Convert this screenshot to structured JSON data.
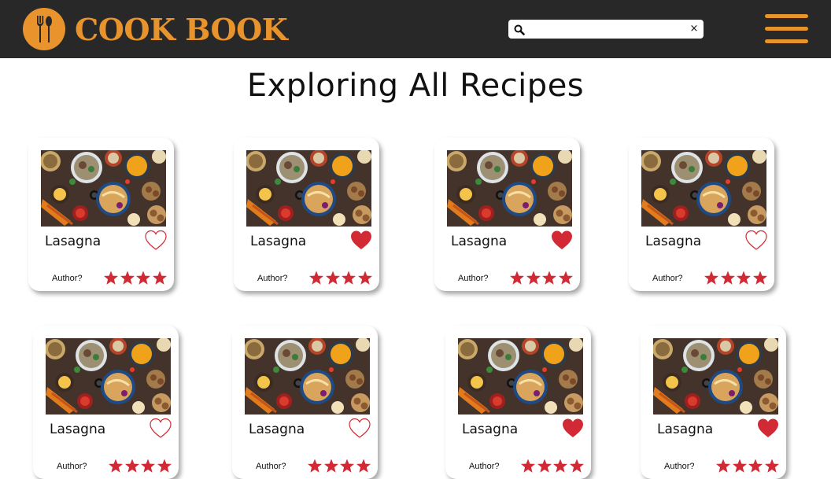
{
  "brand": {
    "name": "COOK BOOK",
    "color": "#e8932c",
    "header_bg": "#282828",
    "icon": "fork-spoon-logo-icon"
  },
  "search": {
    "value": "",
    "placeholder": "",
    "icon": "search-icon",
    "clear_label": "×"
  },
  "menu": {
    "icon": "hamburger-menu-icon"
  },
  "page": {
    "title": "Exploring All Recipes"
  },
  "colors": {
    "heart": "#d12a34",
    "star": "#d12a34"
  },
  "recipes": [
    {
      "title": "Lasagna",
      "author": "Author?",
      "favorited": false,
      "rating": 4
    },
    {
      "title": "Lasagna",
      "author": "Author?",
      "favorited": true,
      "rating": 4
    },
    {
      "title": "Lasagna",
      "author": "Author?",
      "favorited": true,
      "rating": 4
    },
    {
      "title": "Lasagna",
      "author": "Author?",
      "favorited": false,
      "rating": 4
    },
    {
      "title": "Lasagna",
      "author": "Author?",
      "favorited": false,
      "rating": 4
    },
    {
      "title": "Lasagna",
      "author": "Author?",
      "favorited": false,
      "rating": 4
    },
    {
      "title": "Lasagna",
      "author": "Author?",
      "favorited": true,
      "rating": 4
    },
    {
      "title": "Lasagna",
      "author": "Author?",
      "favorited": true,
      "rating": 4
    }
  ]
}
